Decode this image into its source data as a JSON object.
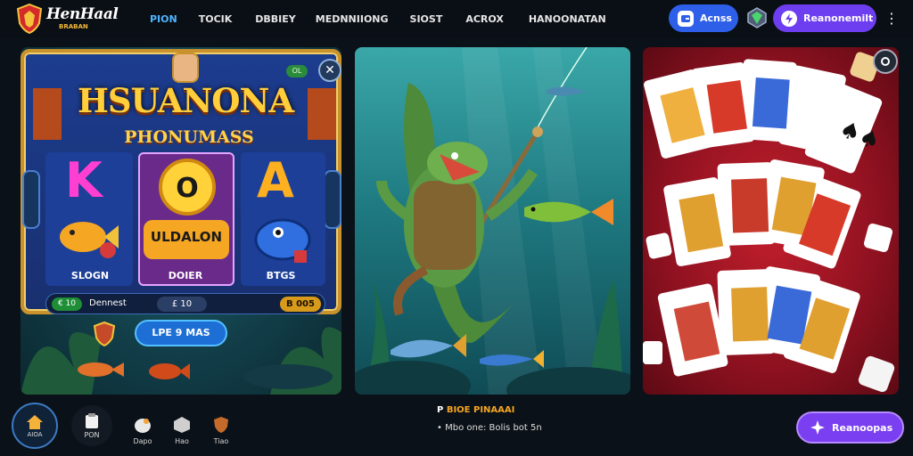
{
  "header": {
    "logo_text": "HenHaal",
    "logo_sub": "BRABAN",
    "nav": [
      "PION",
      "TOCIK",
      "DBBIEY",
      "MEDNNIIONG",
      "SIOST",
      "ACROX",
      "HANOONATAN"
    ],
    "account_label": "Acnss",
    "cta_label": "Reanonemilt",
    "more_icon": "kebab-menu-icon"
  },
  "slot": {
    "title": "HSUANONA",
    "subtitle": "PHONUMASS",
    "ok_chip": "OL",
    "reel_center_label": "ULDALON",
    "reel_labels": [
      "SLOGN",
      "DOIER",
      "BTGS"
    ],
    "status_badge": "€ 10",
    "status_label": "Dennest",
    "status_value": "£ 10",
    "status_value2": "B 005",
    "play_label": "LPE 9 MAS"
  },
  "footer": {
    "nav": [
      {
        "label": "AIOA",
        "icon": "home-icon"
      },
      {
        "label": "PON",
        "icon": "clipboard-icon"
      },
      {
        "label": "Dapo",
        "icon": "egg-icon"
      },
      {
        "label": "Hao",
        "icon": "dice-icon"
      },
      {
        "label": "Tiao",
        "icon": "shield-icon"
      }
    ],
    "center_title_prefix": "P",
    "center_title": "BIOE PINAAAI",
    "center_line": "Mbo one: Bolis bot 5n",
    "center_bullet": "•",
    "cta_label": "Reanoopas"
  },
  "colors": {
    "accent_blue": "#2d5fe8",
    "accent_purple": "#6d3ef0",
    "gold": "#ffce3a",
    "card_red": "#c31f2c"
  }
}
